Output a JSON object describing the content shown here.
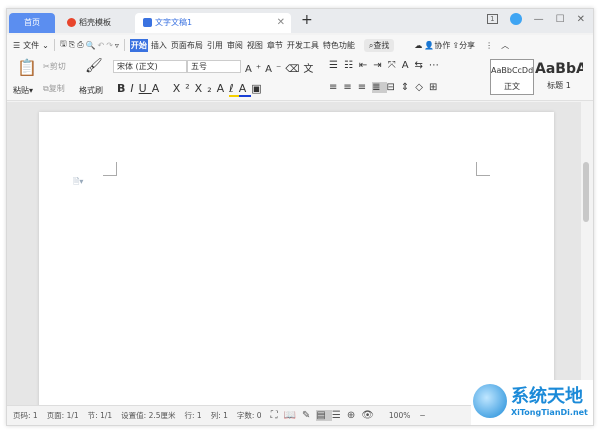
{
  "tabs": [
    {
      "label": "首页"
    },
    {
      "label": "稻壳模板"
    },
    {
      "label": "文字文稿1"
    }
  ],
  "window": {
    "page_count_badge": "1"
  },
  "menu": {
    "file": "文件",
    "items": [
      "开始",
      "插入",
      "页面布局",
      "引用",
      "审阅",
      "视图",
      "章节",
      "开发工具",
      "特色功能"
    ],
    "search": "查找",
    "collab": "协作",
    "share": "分享"
  },
  "ribbon": {
    "paste": "粘贴",
    "cut": "剪切",
    "copy": "复制",
    "format_painter": "格式刷",
    "font": "宋体 (正文)",
    "size": "五号",
    "styles": [
      {
        "preview": "AaBbCcDd",
        "label": "正文"
      },
      {
        "preview": "AaBbA",
        "label": "标题 1"
      }
    ]
  },
  "status": {
    "items": [
      "页码: 1",
      "页面: 1/1",
      "节: 1/1",
      "设置值: 2.5厘米",
      "行: 1",
      "列: 1",
      "字数: 0"
    ],
    "zoom": "100%"
  },
  "watermark": {
    "brand": "系统天地",
    "url": "XiTongTianDi.net"
  },
  "colors": {
    "accent": "#3a72e0",
    "home_tab": "#5b8ef0"
  }
}
